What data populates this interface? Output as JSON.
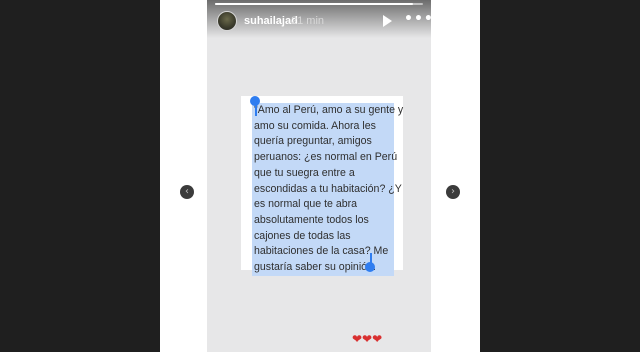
{
  "story": {
    "username": "suhailajad",
    "time": "21 min",
    "progress": 0.95,
    "icons": {
      "play": "play-icon",
      "more": "more-options-icon",
      "prev": "chevron-left-icon",
      "next": "chevron-right-icon"
    },
    "quote_lines": [
      "\"Amo al Perú, amo a su gente y",
      "amo su comida. Ahora les",
      "quería preguntar, amigos",
      "peruanos: ¿es normal en Perú",
      "que tu suegra entre a",
      "escondidas a tu habitación? ¿Y",
      "es normal que te abra",
      "absolutamente todos los",
      "cajones de todas las",
      "habitaciones de la casa? Me",
      "gustaría saber su opinión."
    ],
    "hearts": "❤❤❤",
    "colors": {
      "selection": "#c3d9f7",
      "handle": "#2f7df0",
      "heart": "#d93030"
    }
  }
}
